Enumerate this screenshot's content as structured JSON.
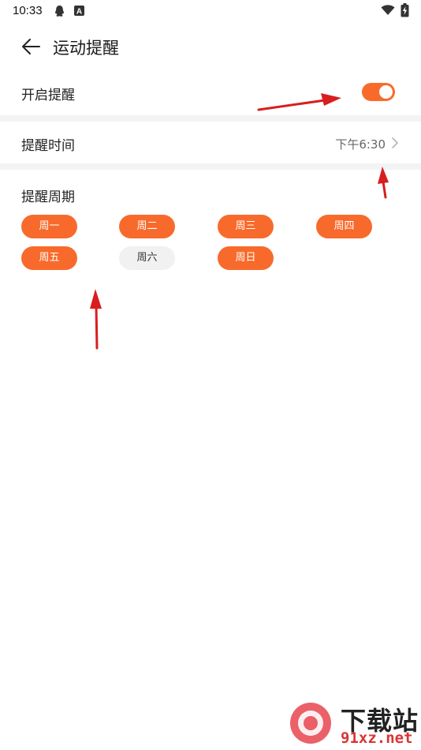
{
  "status_bar": {
    "time": "10:33",
    "icons": [
      "qq-icon",
      "a-badge-icon",
      "wifi-icon",
      "battery-charging-icon"
    ],
    "badge_letter": "A"
  },
  "header": {
    "title": "运动提醒",
    "back_icon": "arrow-left-icon"
  },
  "settings": {
    "enable_label": "开启提醒",
    "enable_on": true,
    "time_label": "提醒时间",
    "time_value": "下午6:30",
    "period_label": "提醒周期"
  },
  "days": [
    {
      "label": "周一",
      "selected": true
    },
    {
      "label": "周二",
      "selected": true
    },
    {
      "label": "周三",
      "selected": true
    },
    {
      "label": "周四",
      "selected": true
    },
    {
      "label": "周五",
      "selected": true
    },
    {
      "label": "周六",
      "selected": false
    },
    {
      "label": "周日",
      "selected": true
    }
  ],
  "watermark": {
    "main": "下载站",
    "sub": "91xz.net"
  },
  "colors": {
    "accent": "#f86a2b",
    "annotation_arrow": "#d81e1e",
    "divider": "#f3f3f3"
  }
}
